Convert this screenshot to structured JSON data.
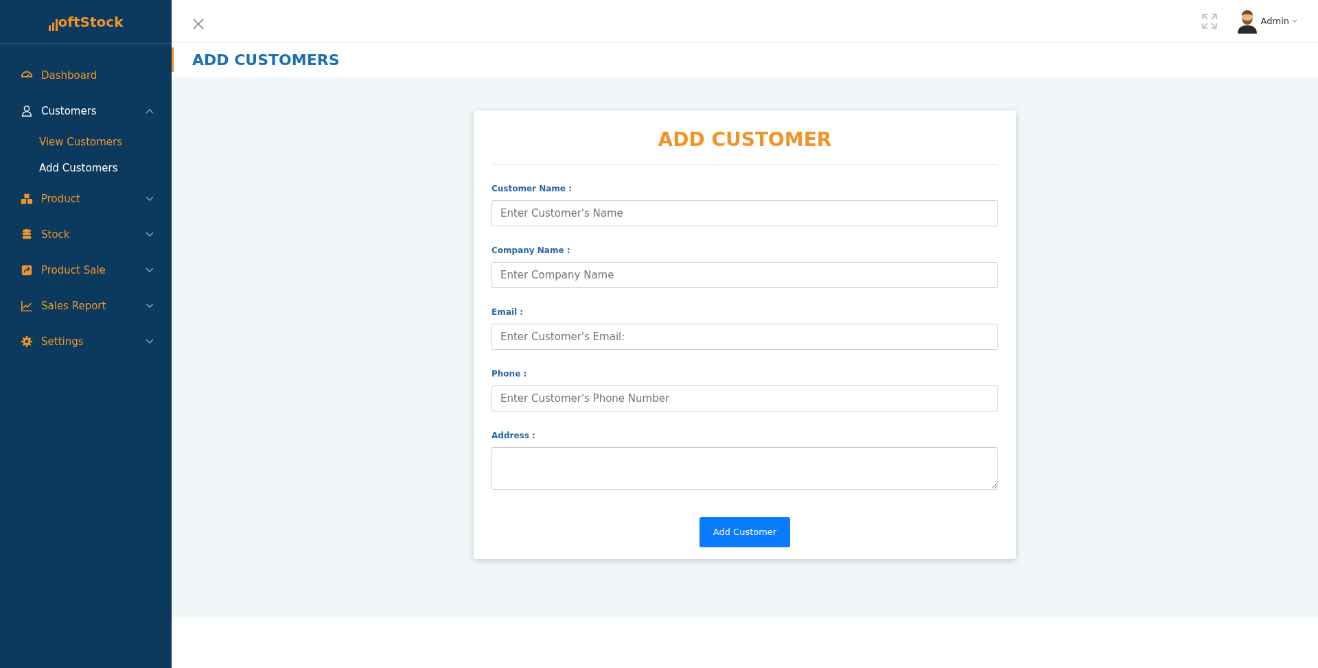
{
  "logo": {
    "text": "oftStock"
  },
  "sidebar": {
    "items": [
      {
        "label": "Dashboard",
        "kind": "link",
        "selected": false
      },
      {
        "label": "Customers",
        "kind": "group",
        "selected": true,
        "expanded": true,
        "children": [
          {
            "label": "View Customers",
            "selected": false
          },
          {
            "label": "Add Customers",
            "selected": true
          }
        ]
      },
      {
        "label": "Product",
        "kind": "group",
        "selected": false,
        "expanded": false
      },
      {
        "label": "Stock",
        "kind": "group",
        "selected": false,
        "expanded": false
      },
      {
        "label": "Product Sale",
        "kind": "group",
        "selected": false,
        "expanded": false
      },
      {
        "label": "Sales Report",
        "kind": "group",
        "selected": false,
        "expanded": false
      },
      {
        "label": "Settings",
        "kind": "group",
        "selected": false,
        "expanded": false
      }
    ]
  },
  "header": {
    "user": "Admin"
  },
  "page_title": "ADD CUSTOMERS",
  "form": {
    "title": "ADD CUSTOMER",
    "fields": [
      {
        "label": "Customer Name :",
        "placeholder": "Enter Customer's Name",
        "kind": "input"
      },
      {
        "label": "Company Name :",
        "placeholder": "Enter Company Name",
        "kind": "input"
      },
      {
        "label": "Email :",
        "placeholder": "Enter Customer's Email:",
        "kind": "input"
      },
      {
        "label": "Phone :",
        "placeholder": "Enter Customer's Phone Number",
        "kind": "input"
      },
      {
        "label": "Address :",
        "kind": "textarea"
      }
    ],
    "submit": "Add Customer"
  }
}
